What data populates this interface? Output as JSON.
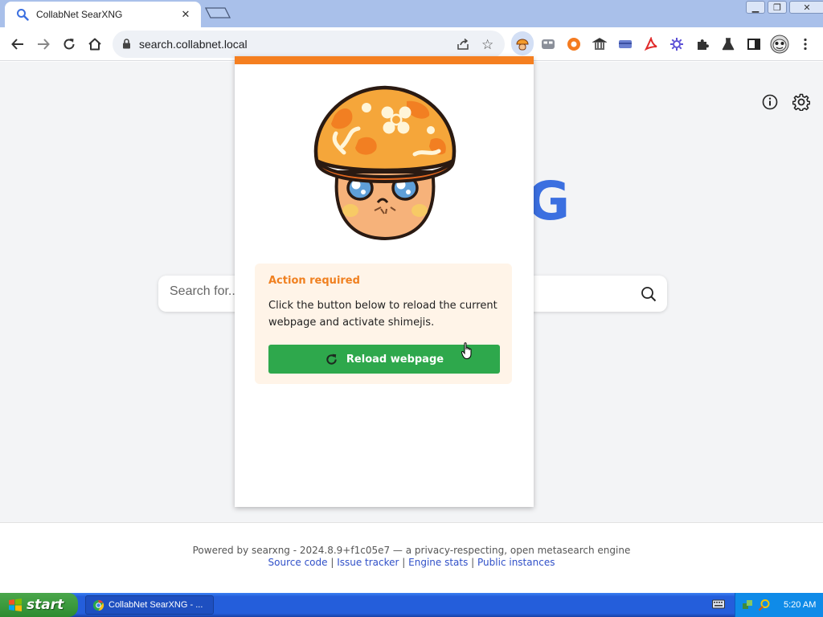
{
  "browser": {
    "tab_title": "CollabNet SearXNG",
    "url": "search.collabnet.local"
  },
  "page": {
    "search_placeholder": "Search for...",
    "logo_fragment": "G",
    "footer": {
      "powered_text": "Powered by searxng - 2024.8.9+f1c05e7 — a privacy-respecting, open metasearch engine",
      "links": [
        "Source code",
        "Issue tracker",
        "Engine stats",
        "Public instances"
      ],
      "separator": " | "
    }
  },
  "popup": {
    "accent_color": "#f57f20",
    "notice_title": "Action required",
    "notice_text": "Click the button below to reload the current webpage and activate shimejis.",
    "button_label": "Reload webpage",
    "button_color": "#2ea84c"
  },
  "taskbar": {
    "start_label": "start",
    "task_label": "CollabNet SearXNG - ...",
    "clock": "5:20 AM"
  }
}
